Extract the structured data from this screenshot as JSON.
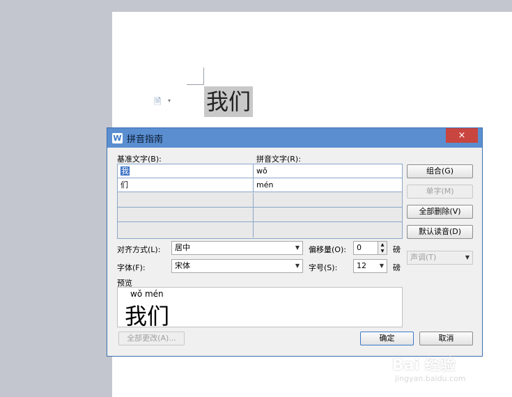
{
  "document": {
    "selected_text": "我们",
    "paste_icon": "clipboard-icon"
  },
  "dialog": {
    "title": "拼音指南",
    "logo": "W",
    "close": "×",
    "base_label": "基准文字(B):",
    "ruby_label": "拼音文字(R):",
    "rows": [
      {
        "base": "我",
        "ruby": "wǒ"
      },
      {
        "base": "们",
        "ruby": "mén"
      },
      {
        "base": "",
        "ruby": ""
      },
      {
        "base": "",
        "ruby": ""
      },
      {
        "base": "",
        "ruby": ""
      }
    ],
    "buttons": {
      "group": "组合(G)",
      "single": "单字(M)",
      "clear_all": "全部删除(V)",
      "default_reading": "默认读音(D)",
      "tone": "声调(T)",
      "change_all": "全部更改(A)...",
      "ok": "确定",
      "cancel": "取消"
    },
    "align_label": "对齐方式(L):",
    "align_value": "居中",
    "offset_label": "偏移量(O):",
    "offset_value": "0",
    "offset_unit": "磅",
    "font_label": "字体(F):",
    "font_value": "宋体",
    "size_label": "字号(S):",
    "size_value": "12",
    "size_unit": "磅",
    "preview_label": "预览",
    "preview_pinyin": "wǒ  mén",
    "preview_text": "我们"
  },
  "watermark": {
    "text": "Bai 经验",
    "sub": "jingyan.baidu.com"
  }
}
